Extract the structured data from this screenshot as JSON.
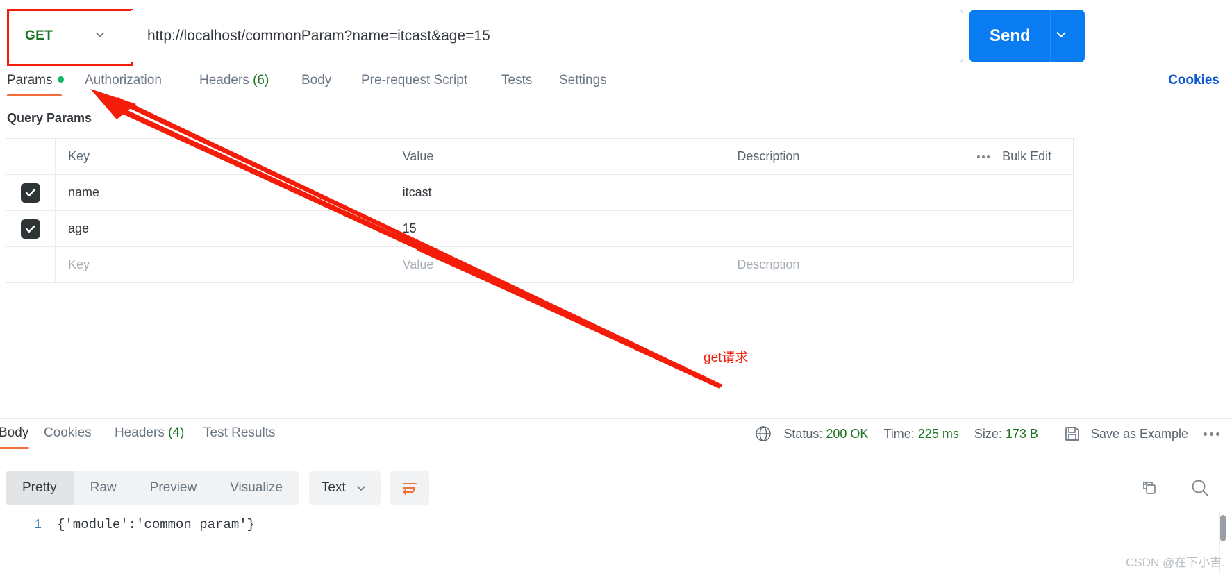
{
  "request": {
    "method": "GET",
    "url": "http://localhost/commonParam?name=itcast&age=15",
    "send_label": "Send",
    "cookies_label": "Cookies",
    "tabs": [
      {
        "label": "Params",
        "badge": "dot",
        "active": true
      },
      {
        "label": "Authorization",
        "badge": "",
        "active": false
      },
      {
        "label": "Headers",
        "badge": "(6)",
        "active": false
      },
      {
        "label": "Body",
        "badge": "",
        "active": false
      },
      {
        "label": "Pre-request Script",
        "badge": "",
        "active": false
      },
      {
        "label": "Tests",
        "badge": "",
        "active": false
      },
      {
        "label": "Settings",
        "badge": "",
        "active": false
      }
    ]
  },
  "query_params": {
    "section_title": "Query Params",
    "headers": {
      "key": "Key",
      "value": "Value",
      "description": "Description",
      "bulk_edit": "Bulk Edit"
    },
    "rows": [
      {
        "checked": true,
        "key": "name",
        "value": "itcast",
        "description": ""
      },
      {
        "checked": true,
        "key": "age",
        "value": "15",
        "description": ""
      }
    ],
    "empty_row": {
      "key_placeholder": "Key",
      "value_placeholder": "Value",
      "description_placeholder": "Description"
    }
  },
  "annotation": {
    "text": "get请求",
    "color": "#f41d09"
  },
  "response": {
    "tabs": [
      {
        "label": "Body",
        "badge": "",
        "active": true
      },
      {
        "label": "Cookies",
        "badge": "",
        "active": false
      },
      {
        "label": "Headers",
        "badge": "(4)",
        "active": false
      },
      {
        "label": "Test Results",
        "badge": "",
        "active": false
      }
    ],
    "status_label": "Status:",
    "status_value": "200 OK",
    "time_label": "Time:",
    "time_value": "225 ms",
    "size_label": "Size:",
    "size_value": "173 B",
    "save_as_example": "Save as Example",
    "viewer_modes": [
      {
        "label": "Pretty",
        "active": true
      },
      {
        "label": "Raw",
        "active": false
      },
      {
        "label": "Preview",
        "active": false
      },
      {
        "label": "Visualize",
        "active": false
      }
    ],
    "format_select": "Text",
    "body_line_number": "1",
    "body_text": "{'module':'common param'}"
  },
  "watermark": "CSDN @在下小吉.",
  "colors": {
    "accent_orange": "#f3703a",
    "send_blue": "#0a7cf1",
    "link_blue": "#0a56d0",
    "success_green": "#1d7324",
    "annotation_red": "#f41d09"
  }
}
